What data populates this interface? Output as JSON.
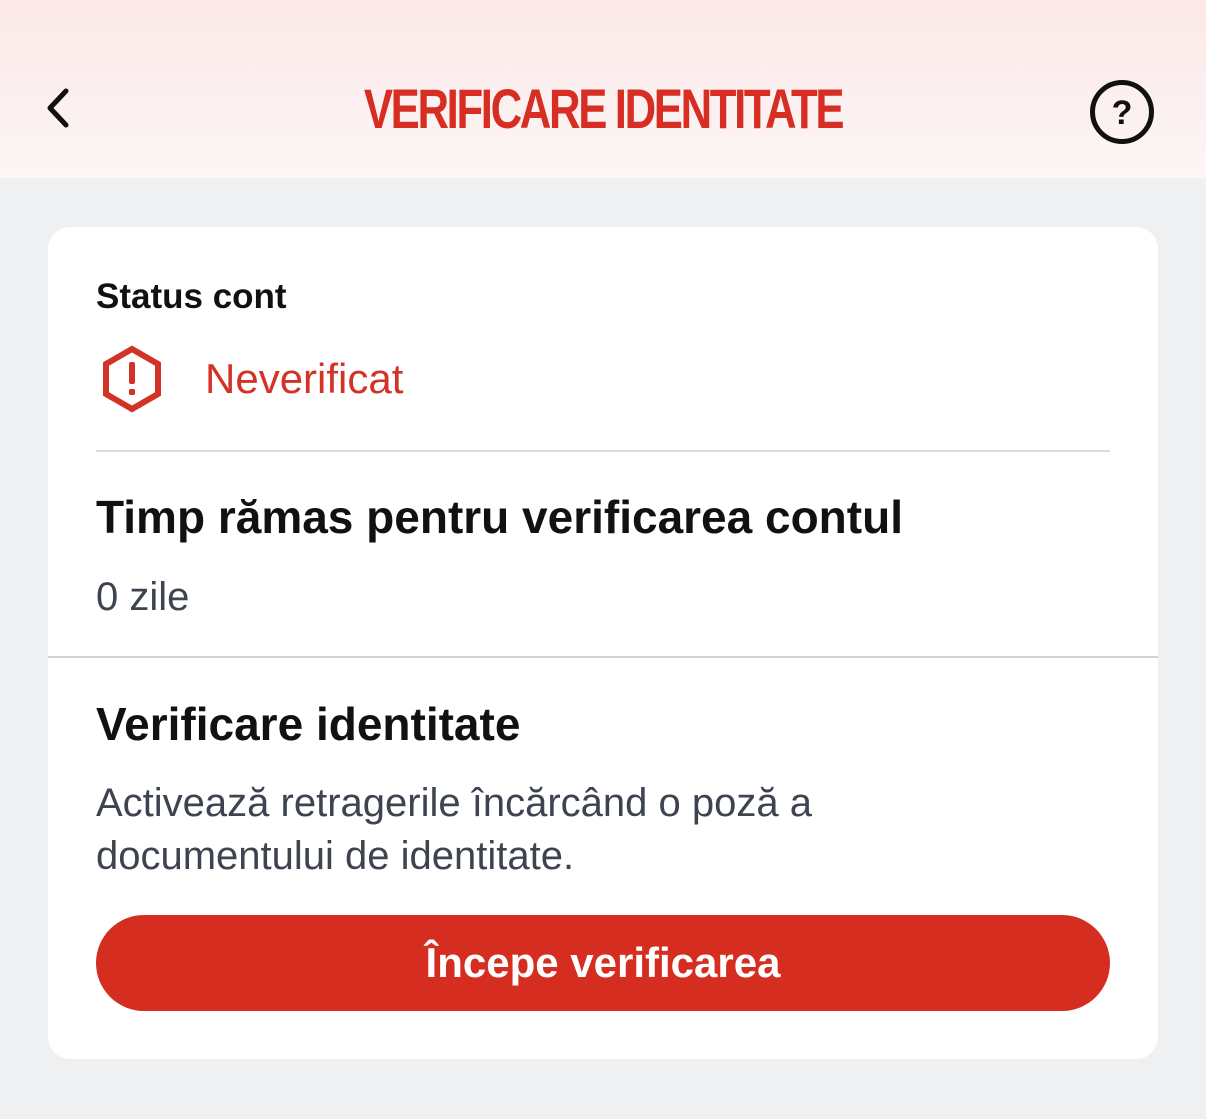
{
  "header": {
    "title": "VERIFICARE IDENTITATE",
    "back_icon": "chevron-left-icon",
    "help_icon": "help-circle-icon"
  },
  "account_status": {
    "label": "Status cont",
    "value": "Neverificat",
    "icon": "alert-hexagon-icon"
  },
  "time_remaining": {
    "heading": "Timp rămas pentru verificarea contul",
    "value": "0 zile"
  },
  "identity_verification": {
    "heading": "Verificare identitate",
    "description": "Activează retragerile încărcând o poză a documentului de identitate.",
    "button_label": "Începe verificarea"
  },
  "colors": {
    "accent": "#d52e21",
    "header_bg": "#fbe8e8",
    "page_bg": "#eff0f2",
    "card_bg": "#ffffff",
    "secondary_text": "#3d4450"
  }
}
